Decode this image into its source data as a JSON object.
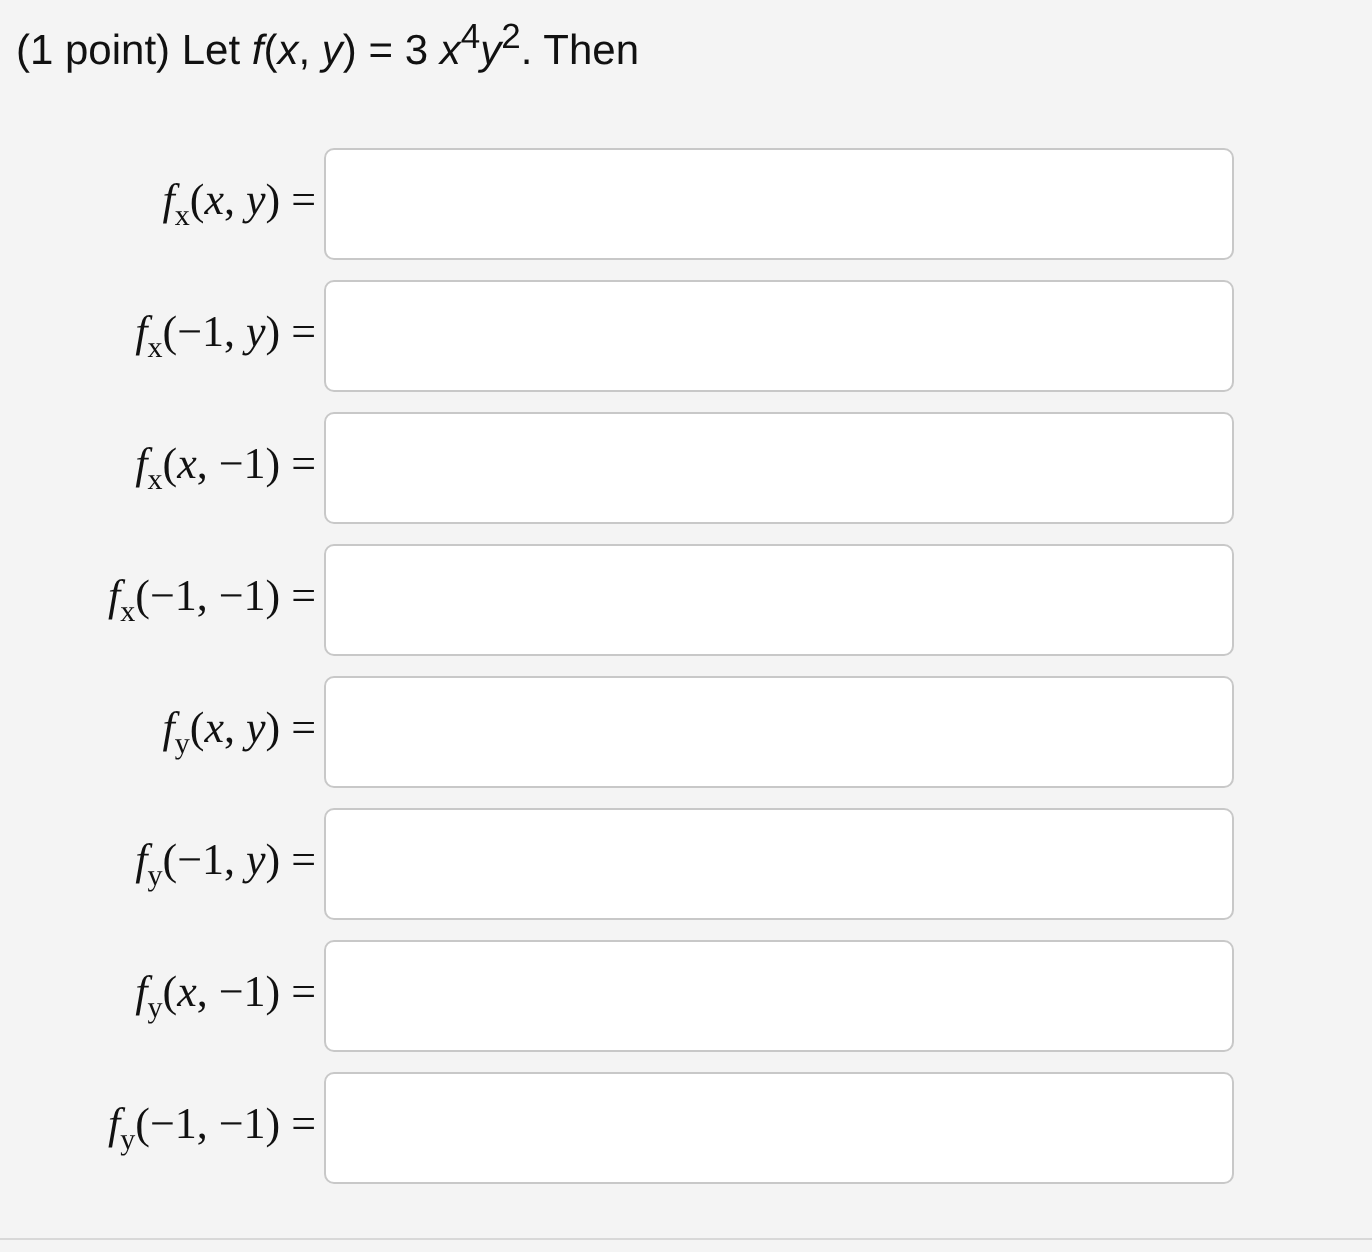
{
  "problem": {
    "statement": "(1 point) Let *f*(*x*, *y*) = 3 *x*$^{4}$*y*$^{2}$. Then"
  },
  "answers": [
    {
      "label": "*f*$_{x}$(*x*, *y*) ="
    },
    {
      "label": "*f*$_{x}$(−1, *y*) ="
    },
    {
      "label": "*f*$_{x}$(*x*, −1) ="
    },
    {
      "label": "*f*$_{x}$(−1, −1) ="
    },
    {
      "label": "*f*$_{y}$(*x*, *y*) ="
    },
    {
      "label": "*f*$_{y}$(−1, *y*) ="
    },
    {
      "label": "*f*$_{y}$(*x*, −1) ="
    },
    {
      "label": "*f*$_{y}$(−1, −1) ="
    }
  ]
}
